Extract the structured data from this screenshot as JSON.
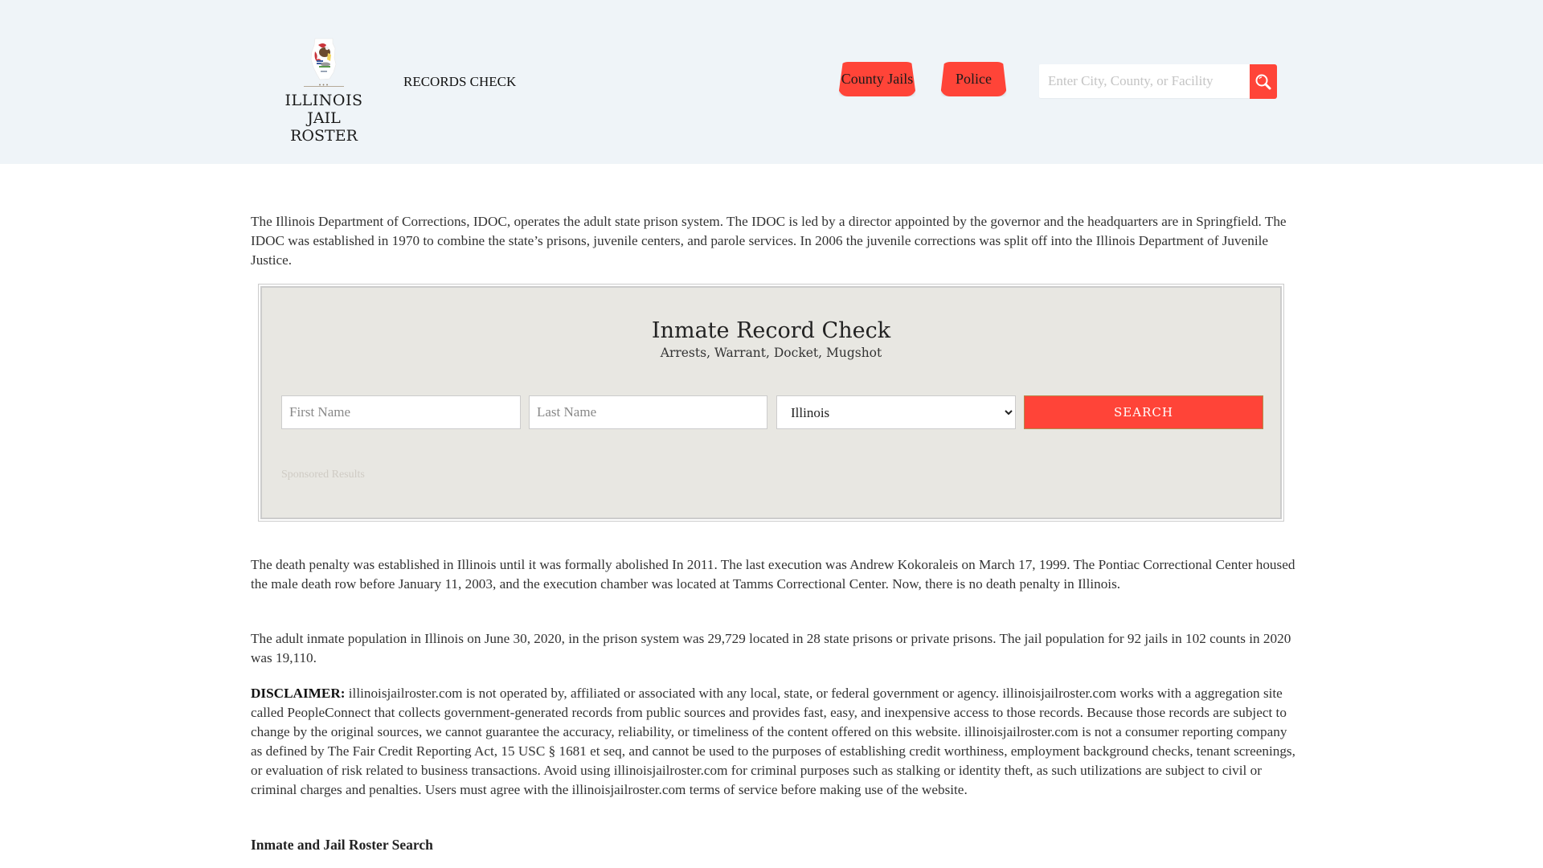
{
  "header": {
    "logo": {
      "line1": "ILLINOIS",
      "line2": "JAIL ROSTER",
      "dots": "•••"
    },
    "records_check_link": "RECORDS CHECK",
    "nav_tabs": [
      {
        "label": "County Jails"
      },
      {
        "label": "Police"
      }
    ],
    "search": {
      "placeholder": "Enter City, County, or Facility",
      "value": "",
      "button_icon": "search-icon"
    },
    "colors": {
      "background": "#eff4f8",
      "accent": "#ff4438"
    }
  },
  "main": {
    "intro_paragraph": "The Illinois Department of Corrections, IDOC, operates the adult state prison system. The IDOC is led by a director appointed by the governor and the headquarters are in Springfield. The IDOC was established in 1970 to combine the state’s prisons, juvenile centers, and parole services. In 2006 the juvenile corrections was split off into the Illinois Department of Juvenile Justice.",
    "record_check": {
      "title": "Inmate Record Check",
      "subtitle": "Arrests, Warrant, Docket, Mugshot",
      "first_name_placeholder": "First Name",
      "last_name_placeholder": "Last Name",
      "state_selected": "Illinois",
      "search_button": "SEARCH",
      "sponsored_label": "Sponsored Results",
      "background": "#e8e7e2"
    },
    "death_penalty_paragraph": "The death penalty was established in Illinois until it was formally abolished In 2011. The last execution was Andrew Kokoraleis on March 17, 1999. The Pontiac Correctional Center housed the male death row before January 11, 2003, and the execution chamber was located at Tamms Correctional Center. Now, there is no death penalty in Illinois.",
    "population_paragraph": "The adult inmate population in Illinois on June 30, 2020, in the prison system was 29,729 located in 28 state prisons or private prisons. The jail population for 92 jails in 102 counts in 2020 was 19,110.",
    "disclaimer": {
      "label": "DISCLAIMER:",
      "text": " illinoisjailroster.com is not operated by, affiliated or associated with any local, state, or federal government or agency. illinoisjailroster.com works with a aggregation site called PeopleConnect that collects government-generated records from public sources and provides fast, easy, and inexpensive access to those records. Because those records are subject to change by the original sources, we cannot guarantee the accuracy, reliability, or timeliness of the content offered on this website. illinoisjailroster.com is not a consumer reporting company as defined by The Fair Credit Reporting Act, 15 USC § 1681 et seq, and cannot be used to the purposes of establishing credit worthiness, employment background checks, tenant screenings, or evaluation of risk related to business transactions. Avoid using illinoisjailroster.com for criminal purposes such as stalking or identity theft, as such utilizations are subject to civil or criminal charges and penalties. Users must agree with the illinoisjailroster.com terms of service before making use of the website."
    },
    "section_heading": "Inmate and Jail Roster Search"
  }
}
